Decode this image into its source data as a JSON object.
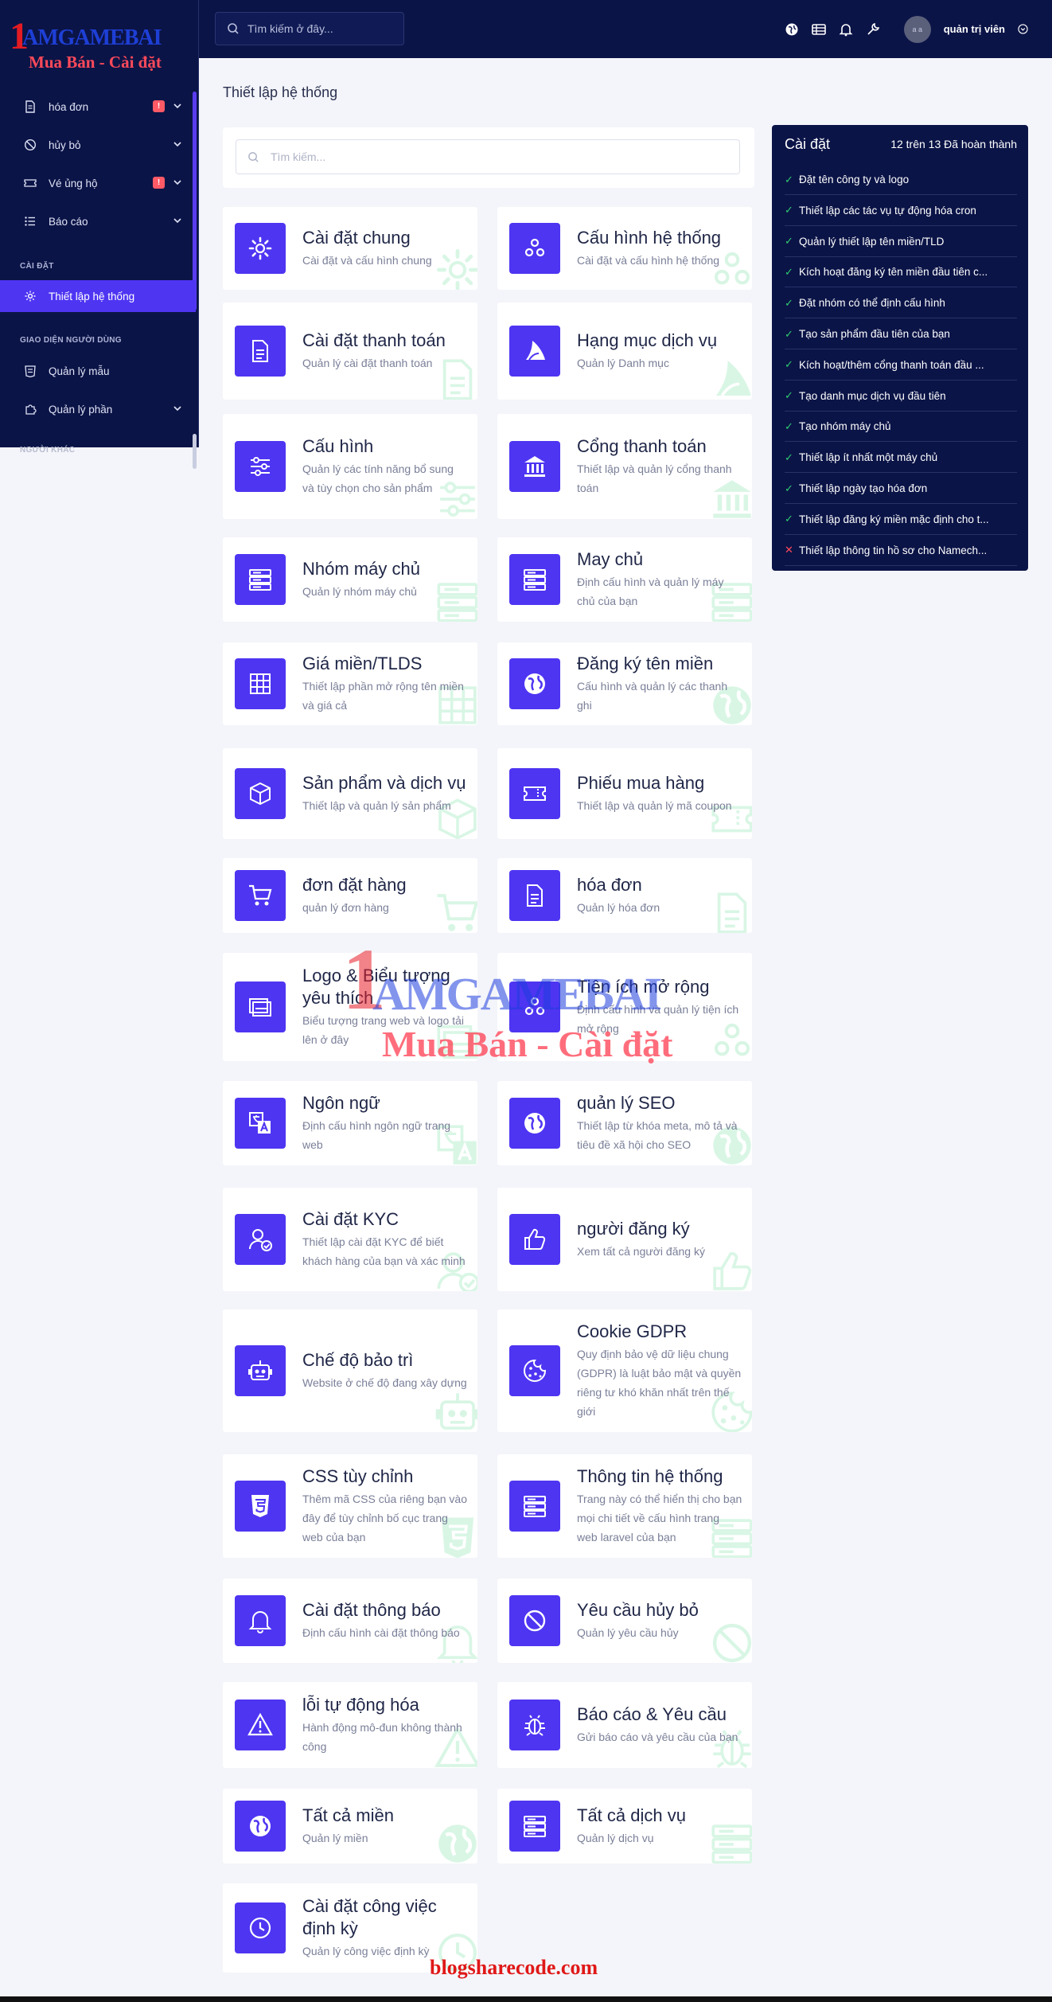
{
  "header": {
    "search_placeholder": "Tìm kiếm ở đây...",
    "user_name": "quản trị viên",
    "avatar_text": "a a"
  },
  "logo": {
    "line1": "1",
    "line2": "AMGAMEBAI",
    "line3": "Mua Bán - Cài đặt"
  },
  "sidebar": {
    "items": [
      {
        "label": "hóa đơn",
        "badge": "!"
      },
      {
        "label": "hủy bỏ"
      },
      {
        "label": "Vé ủng hộ",
        "badge": "!"
      },
      {
        "label": "Báo cáo"
      }
    ],
    "section_settings": "CÀI ĐẶT",
    "active_item": "Thiết lập hệ thống",
    "section_ui": "GIAO DIỆN NGƯỜI DÙNG",
    "ui_items": [
      {
        "label": "Quản lý mẫu"
      },
      {
        "label": "Quản lý phần"
      }
    ],
    "section_other": "NGƯỜI KHÁC"
  },
  "main": {
    "title": "Thiết lập hệ thống",
    "search_placeholder": "Tìm kiếm...",
    "cards": [
      {
        "title": "Cài đặt chung",
        "desc": "Cài đặt và cấu hình chung",
        "icon": "gear-icon"
      },
      {
        "title": "Cấu hình hệ thống",
        "desc": "Cài đặt và cấu hình hệ thống",
        "icon": "gears-icon"
      },
      {
        "title": "Cài đặt thanh toán",
        "desc": "Quản lý cài đặt thanh toán",
        "icon": "document-icon"
      },
      {
        "title": "Hạng mục dịch vụ",
        "desc": "Quản lý Danh mục",
        "icon": "sail-icon"
      },
      {
        "title": "Cấu hình",
        "desc": "Quản lý các tính năng bổ sung và tùy chọn cho sản phẩm",
        "icon": "sliders-icon"
      },
      {
        "title": "Cổng thanh toán",
        "desc": "Thiết lập và quản lý cổng thanh toán",
        "icon": "bank-icon"
      },
      {
        "title": "Nhóm máy chủ",
        "desc": "Quản lý nhóm máy chủ",
        "icon": "server-icon"
      },
      {
        "title": "May chủ",
        "desc": "Định cấu hình và quản lý máy chủ của bạn",
        "icon": "server-icon"
      },
      {
        "title": "Giá miền/TLDS",
        "desc": "Thiết lập phần mở rộng tên miền và giá cả",
        "icon": "grid-icon"
      },
      {
        "title": "Đăng ký tên miền",
        "desc": "Cấu hình và quản lý các thanh ghi",
        "icon": "globe-icon"
      },
      {
        "title": "Sản phẩm và dịch vụ",
        "desc": "Thiết lập và quản lý sản phẩm",
        "icon": "box-icon"
      },
      {
        "title": "Phiếu mua hàng",
        "desc": "Thiết lập và quản lý mã coupon",
        "icon": "ticket-icon"
      },
      {
        "title": "đơn đặt hàng",
        "desc": "quản lý đơn hàng",
        "icon": "cart-icon"
      },
      {
        "title": "hóa đơn",
        "desc": "Quản lý hóa đơn",
        "icon": "document-icon"
      },
      {
        "title": "Logo & Biểu tượng yêu thích",
        "desc": "Biểu tượng trang web và logo tải lên ở đây",
        "icon": "images-icon"
      },
      {
        "title": "Tiện ích mở rộng",
        "desc": "Định cấu hình và quản lý tiện ích mở rộng",
        "icon": "gears-icon"
      },
      {
        "title": "Ngôn ngữ",
        "desc": "Định cấu hình ngôn ngữ trang web",
        "icon": "translate-icon"
      },
      {
        "title": "quản lý SEO",
        "desc": "Thiết lập từ khóa meta, mô tả và tiêu đề xã hội cho SEO",
        "icon": "globe-icon"
      },
      {
        "title": "Cài đặt KYC",
        "desc": "Thiết lập cài đặt KYC để biết khách hàng của bạn và xác minh",
        "icon": "user-check-icon"
      },
      {
        "title": "người đăng ký",
        "desc": "Xem tất cả người đăng ký",
        "icon": "thumbs-up-icon"
      },
      {
        "title": "Chế độ bảo trì",
        "desc": "Website ở chế độ đang xây dựng",
        "icon": "robot-icon"
      },
      {
        "title": "Cookie GDPR",
        "desc": "Quy định bảo vệ dữ liệu chung (GDPR) là luật bảo mật và quyền riêng tư khó khăn nhất trên thế giới",
        "icon": "cookie-icon"
      },
      {
        "title": "CSS tùy chỉnh",
        "desc": "Thêm mã CSS của riêng bạn vào đây để tùy chỉnh bố cục trang web của bạn",
        "icon": "css3-icon"
      },
      {
        "title": "Thông tin hệ thống",
        "desc": "Trang này có thể hiển thị cho bạn mọi chi tiết về cấu hình trang web laravel của bạn",
        "icon": "server-icon"
      },
      {
        "title": "Cài đặt thông báo",
        "desc": "Định cấu hình cài đặt thông báo",
        "icon": "bell-icon"
      },
      {
        "title": "Yêu cầu hủy bỏ",
        "desc": "Quản lý yêu cầu hủy",
        "icon": "ban-icon"
      },
      {
        "title": "lỗi tự động hóa",
        "desc": "Hành động mô-đun không thành công",
        "icon": "warning-icon"
      },
      {
        "title": "Báo cáo & Yêu cầu",
        "desc": "Gửi báo cáo và yêu cầu của bạn",
        "icon": "bug-icon"
      },
      {
        "title": "Tất cả miền",
        "desc": "Quản lý miền",
        "icon": "globe-icon"
      },
      {
        "title": "Tất cả dịch vụ",
        "desc": "Quản lý dịch vụ",
        "icon": "server-icon"
      },
      {
        "title": "Cài đặt công việc định kỳ",
        "desc": "Quản lý công việc định kỳ",
        "icon": "clock-icon"
      }
    ]
  },
  "checklist": {
    "title": "Cài đặt",
    "progress": "12 trên 13 Đã hoàn thành",
    "items": [
      {
        "label": "Đặt tên công ty và logo",
        "done": true
      },
      {
        "label": "Thiết lập các tác vụ tự động hóa cron",
        "done": true
      },
      {
        "label": "Quản lý thiết lập tên miền/TLD",
        "done": true
      },
      {
        "label": "Kích hoạt đăng ký tên miền đầu tiên c...",
        "done": true
      },
      {
        "label": "Đặt nhóm có thể định cấu hình",
        "done": true
      },
      {
        "label": "Tạo sản phẩm đầu tiên của bạn",
        "done": true
      },
      {
        "label": "Kích hoạt/thêm cổng thanh toán đầu ...",
        "done": true
      },
      {
        "label": "Tạo danh mục dịch vụ đầu tiên",
        "done": true
      },
      {
        "label": "Tạo nhóm máy chủ",
        "done": true
      },
      {
        "label": "Thiết lập ít nhất một máy chủ",
        "done": true
      },
      {
        "label": "Thiết lập ngày tạo hóa đơn",
        "done": true
      },
      {
        "label": "Thiết lập đăng ký miền mặc định cho t...",
        "done": true
      },
      {
        "label": "Thiết lập thông tin hồ sơ cho Namech...",
        "done": false
      }
    ]
  },
  "watermark": {
    "line1": "1",
    "line2": "AMGAMEBAI",
    "line3": "Mua Bán - Cài đặt"
  },
  "footer": {
    "link": "blogsharecode.com"
  }
}
